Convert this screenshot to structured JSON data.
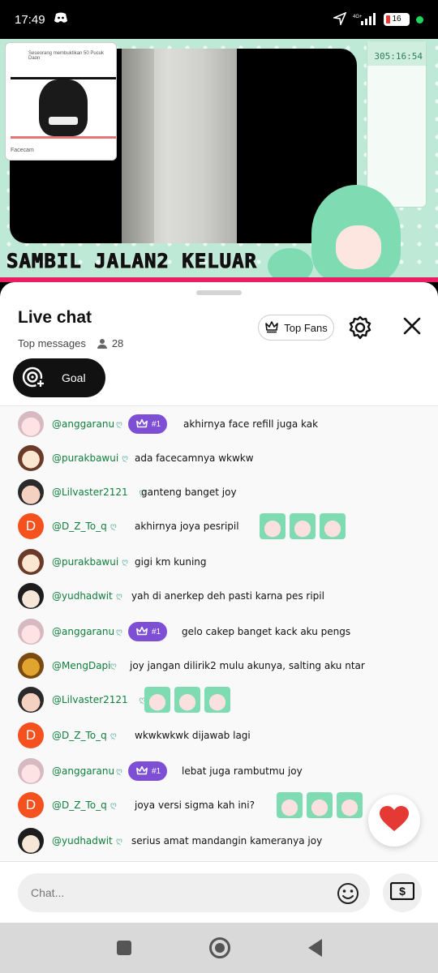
{
  "status_bar": {
    "time": "17:49",
    "battery": "16"
  },
  "stream": {
    "facecam_title": "Seseorang membuktikan 50 Pucuk Daon",
    "facecam_label": "Facecam",
    "timer": "305:16:54",
    "caption": "SAMBIL JALAN2 KELUAR"
  },
  "live_chat": {
    "title": "Live chat",
    "filter": "Top messages",
    "viewers": "28",
    "top_fans_label": "Top Fans",
    "goal_label": "Goal"
  },
  "messages": [
    {
      "user": "@anggaranu",
      "badge": "#1",
      "text": "akhirnya face refill juga kak",
      "avatar": "pink"
    },
    {
      "user": "@purakbawui",
      "badge": "",
      "text": "ada facecamnya wkwkw",
      "avatar": "brown"
    },
    {
      "user": "@Lilvaster2121",
      "badge": "",
      "text": "ganteng banget joy",
      "avatar": "red"
    },
    {
      "user": "@D_Z_To_q",
      "badge": "",
      "text": "akhirnya joya pesripil",
      "avatar": "d",
      "emotes": 3
    },
    {
      "user": "@purakbawui",
      "badge": "",
      "text": "gigi km kuning",
      "avatar": "brown"
    },
    {
      "user": "@yudhadwit",
      "badge": "",
      "text": "yah di anerkep deh pasti karna pes ripil",
      "avatar": "dark"
    },
    {
      "user": "@anggaranu",
      "badge": "#1",
      "text": "gelo cakep banget kack aku pengs",
      "avatar": "pink"
    },
    {
      "user": "@MengDapi",
      "badge": "",
      "text": "joy jangan dilirik2 mulu akunya, salting aku ntar",
      "avatar": "owl"
    },
    {
      "user": "@Lilvaster2121",
      "badge": "",
      "text": "",
      "avatar": "red",
      "emotes": 3
    },
    {
      "user": "@D_Z_To_q",
      "badge": "",
      "text": "wkwkwkwk dijawab lagi",
      "avatar": "d"
    },
    {
      "user": "@anggaranu",
      "badge": "#1",
      "text": "lebat juga rambutmu joy",
      "avatar": "pink"
    },
    {
      "user": "@D_Z_To_q",
      "badge": "",
      "text": "joya versi sigma kah ini?",
      "avatar": "d",
      "emotes": 3
    },
    {
      "user": "@yudhadwit",
      "badge": "",
      "text": "serius amat mandangin kameranya joy",
      "avatar": "dark"
    }
  ],
  "input": {
    "placeholder": "Chat..."
  },
  "colors": {
    "username": "#0f7d3b",
    "badge": "#7e4fd4",
    "avatar_d": "#f4511e",
    "heart": "#e53935"
  }
}
